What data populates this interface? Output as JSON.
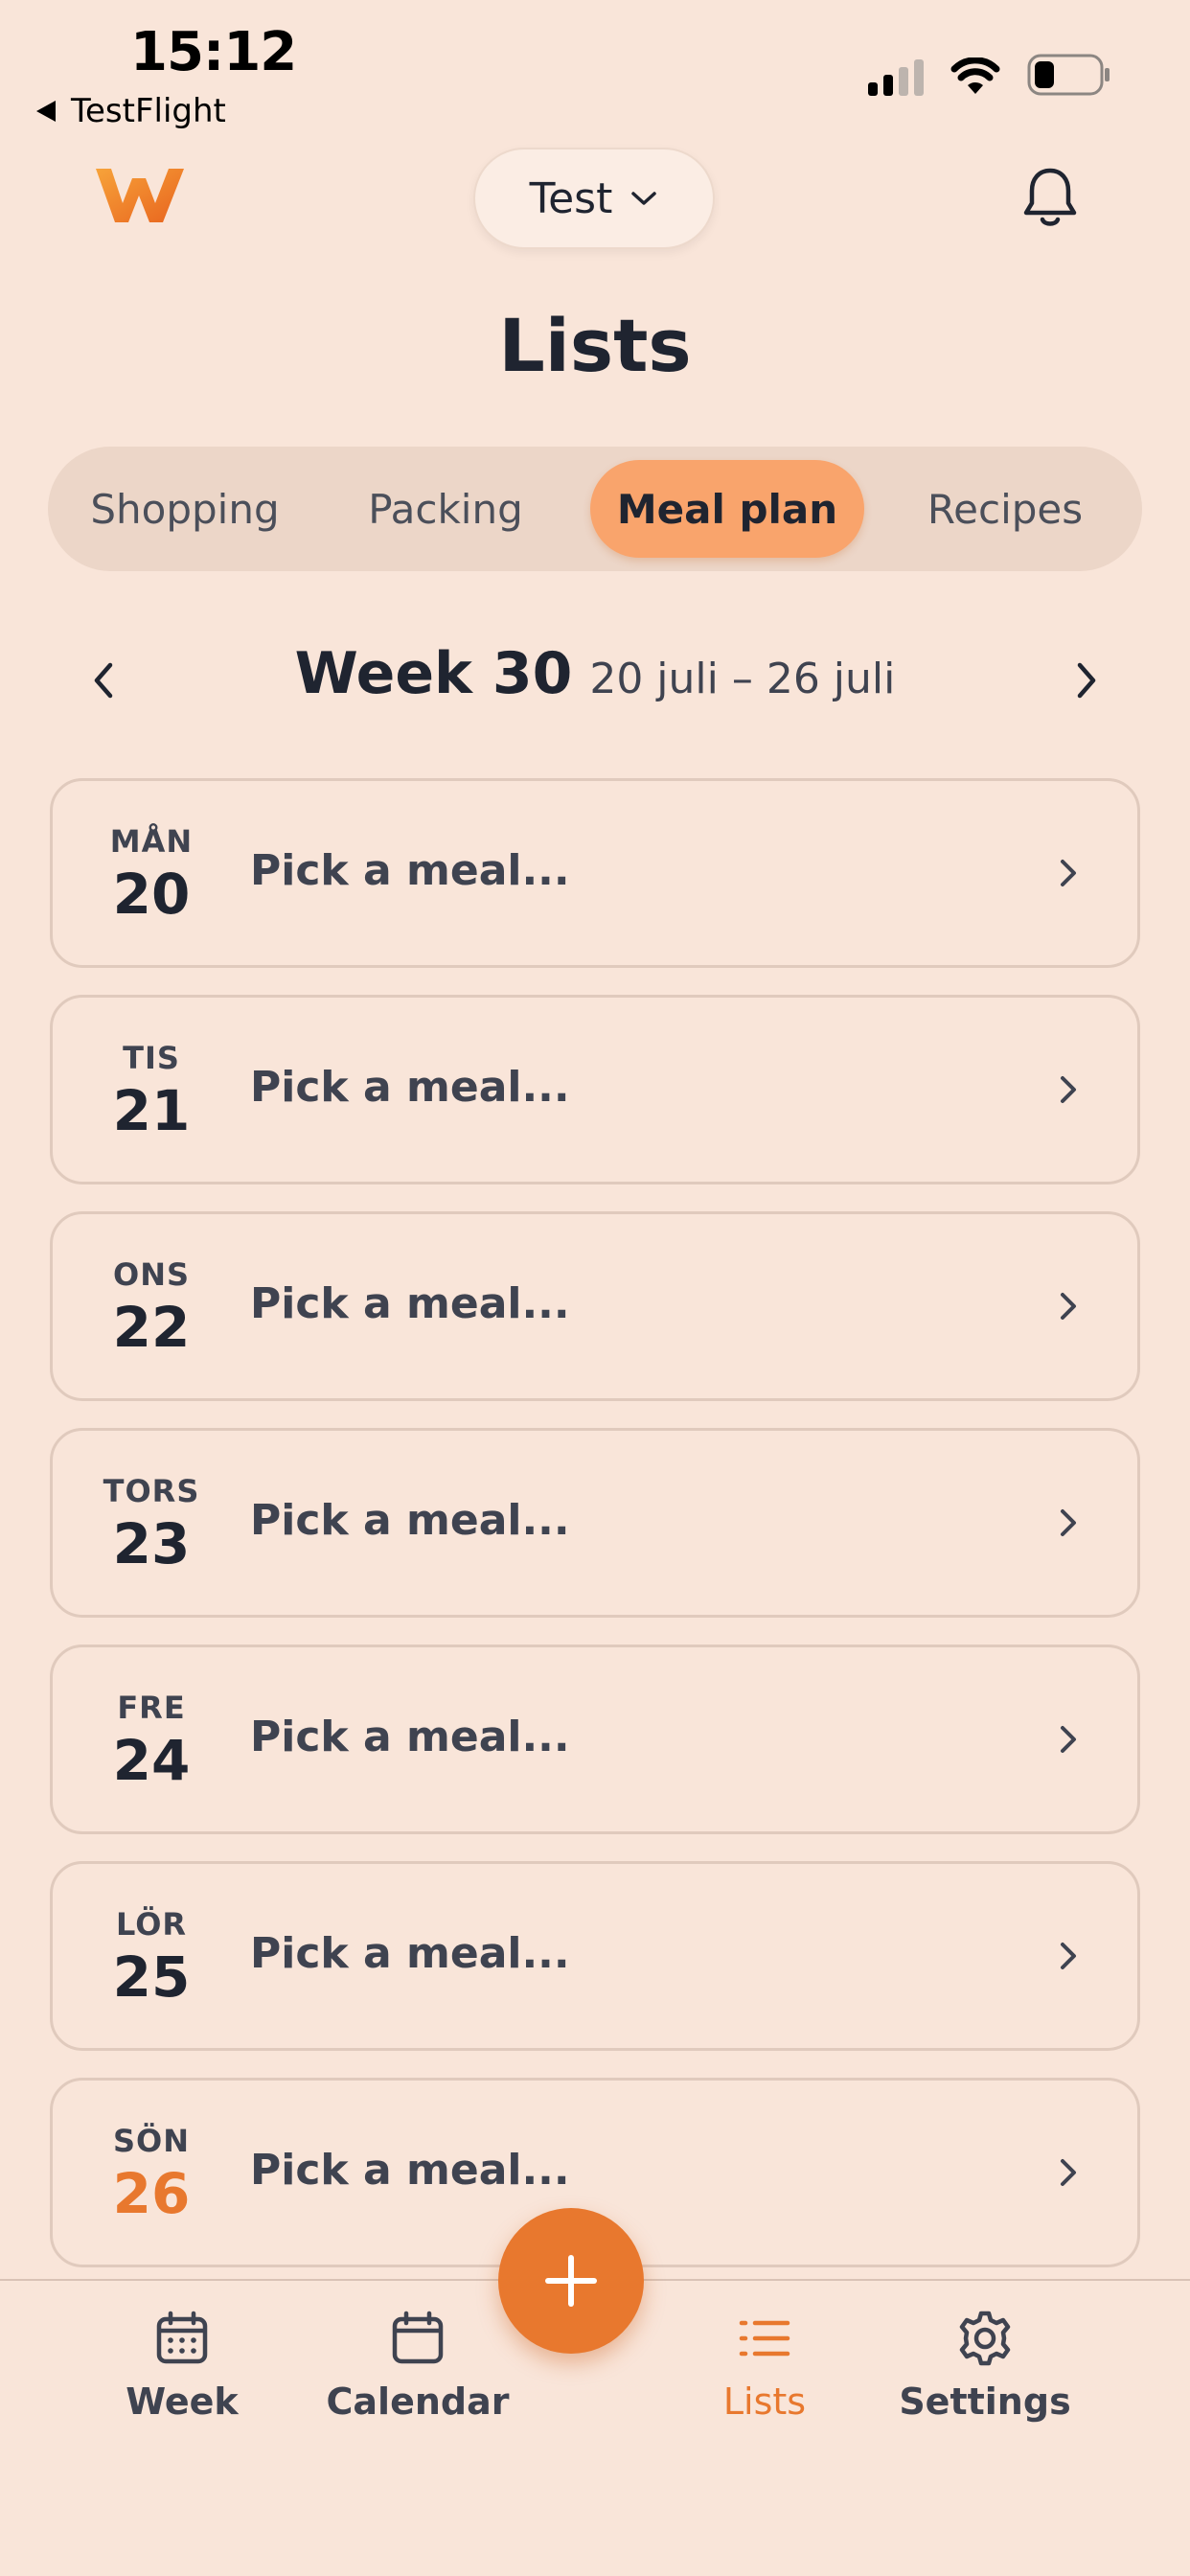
{
  "status_bar": {
    "time": "15:12",
    "back_app": "TestFlight"
  },
  "header": {
    "account_name": "Test",
    "title": "Lists"
  },
  "tabs": [
    {
      "label": "Shopping",
      "active": false
    },
    {
      "label": "Packing",
      "active": false
    },
    {
      "label": "Meal plan",
      "active": true
    },
    {
      "label": "Recipes",
      "active": false
    }
  ],
  "week": {
    "title": "Week 30",
    "range": "20 juli – 26 juli"
  },
  "days": [
    {
      "abbr": "MÅN",
      "num": "20",
      "meal": "Pick a meal...",
      "today": false
    },
    {
      "abbr": "TIS",
      "num": "21",
      "meal": "Pick a meal...",
      "today": false
    },
    {
      "abbr": "ONS",
      "num": "22",
      "meal": "Pick a meal...",
      "today": false
    },
    {
      "abbr": "TORS",
      "num": "23",
      "meal": "Pick a meal...",
      "today": false
    },
    {
      "abbr": "FRE",
      "num": "24",
      "meal": "Pick a meal...",
      "today": false
    },
    {
      "abbr": "LÖR",
      "num": "25",
      "meal": "Pick a meal...",
      "today": false
    },
    {
      "abbr": "SÖN",
      "num": "26",
      "meal": "Pick a meal...",
      "today": true
    }
  ],
  "bottom_nav": [
    {
      "label": "Week",
      "icon": "calendar-grid-icon",
      "active": false
    },
    {
      "label": "Calendar",
      "icon": "calendar-icon",
      "active": false
    },
    {
      "label": "Lists",
      "icon": "list-icon",
      "active": true
    },
    {
      "label": "Settings",
      "icon": "gear-icon",
      "active": false
    }
  ],
  "colors": {
    "background": "#F9E5D9",
    "accent": "#E8782E",
    "active_tab": "#F9A46C",
    "tab_track": "#ECD6C8"
  }
}
